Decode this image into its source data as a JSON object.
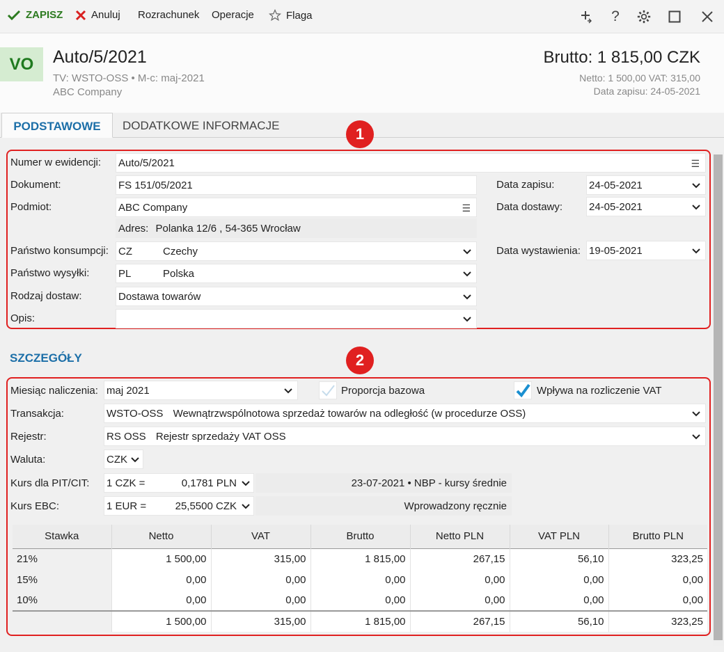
{
  "toolbar": {
    "save": "ZAPISZ",
    "cancel": "Anuluj",
    "rozrachunek": "Rozrachunek",
    "operacje": "Operacje",
    "flaga": "Flaga"
  },
  "header": {
    "badge": "VO",
    "title": "Auto/5/2021",
    "tv_line": "TV: WSTO-OSS  •  M-c: maj-2021",
    "company": "ABC Company",
    "brutto": "Brutto: 1 815,00 CZK",
    "netto_vat": "Netto: 1 500,00 VAT: 315,00",
    "data_zapisu": "Data zapisu: 24-05-2021"
  },
  "tabs": {
    "basic": "PODSTAWOWE",
    "extra": "DODATKOWE INFORMACJE"
  },
  "badges": {
    "one": "1",
    "two": "2"
  },
  "form": {
    "numer_label": "Numer w ewidencji:",
    "numer_value": "Auto/5/2021",
    "dokument_label": "Dokument:",
    "dokument_value": "FS 151/05/2021",
    "podmiot_label": "Podmiot:",
    "podmiot_value": "ABC Company",
    "adres_label": "Adres:",
    "adres_value": "Polanka  12/6 , 54-365 Wrocław",
    "panstwo_konsumpcji_label": "Państwo konsumpcji:",
    "panstwo_konsumpcji_code": "CZ",
    "panstwo_konsumpcji_name": "Czechy",
    "panstwo_wysylki_label": "Państwo wysyłki:",
    "panstwo_wysylki_code": "PL",
    "panstwo_wysylki_name": "Polska",
    "rodzaj_label": "Rodzaj dostaw:",
    "rodzaj_value": "Dostawa towarów",
    "opis_label": "Opis:",
    "opis_value": "",
    "data_zapisu_label": "Data zapisu:",
    "data_zapisu_value": "24-05-2021",
    "data_dostawy_label": "Data dostawy:",
    "data_dostawy_value": "24-05-2021",
    "data_wystawienia_label": "Data wystawienia:",
    "data_wystawienia_value": "19-05-2021"
  },
  "details": {
    "section_title": "SZCZEGÓŁY",
    "miesiac_label": "Miesiąc naliczenia:",
    "miesiac_value": "maj 2021",
    "proporcja_label": "Proporcja bazowa",
    "proporcja_checked": false,
    "wplywa_label": "Wpływa na rozliczenie VAT",
    "wplywa_checked": true,
    "transakcja_label": "Transakcja:",
    "transakcja_code": "WSTO-OSS",
    "transakcja_name": "Wewnątrzwspólnotowa sprzedaż towarów na odległość (w procedurze OSS)",
    "rejestr_label": "Rejestr:",
    "rejestr_code": "RS OSS",
    "rejestr_name": "Rejestr sprzedaży VAT OSS",
    "waluta_label": "Waluta:",
    "waluta_value": "CZK",
    "kurs_pit_label": "Kurs dla PIT/CIT:",
    "kurs_pit_unit": "1 CZK =",
    "kurs_pit_value": "0,1781 PLN",
    "kurs_pit_info": "23-07-2021 • NBP - kursy średnie",
    "kurs_ebc_label": "Kurs EBC:",
    "kurs_ebc_unit": "1 EUR =",
    "kurs_ebc_value": "25,5500 CZK",
    "kurs_ebc_info": "Wprowadzony ręcznie"
  },
  "table": {
    "headers": [
      "Stawka",
      "Netto",
      "VAT",
      "Brutto",
      "Netto PLN",
      "VAT PLN",
      "Brutto PLN"
    ],
    "rows": [
      [
        "21%",
        "1 500,00",
        "315,00",
        "1 815,00",
        "267,15",
        "56,10",
        "323,25"
      ],
      [
        "15%",
        "0,00",
        "0,00",
        "0,00",
        "0,00",
        "0,00",
        "0,00"
      ],
      [
        "10%",
        "0,00",
        "0,00",
        "0,00",
        "0,00",
        "0,00",
        "0,00"
      ]
    ],
    "total": [
      "",
      "1 500,00",
      "315,00",
      "1 815,00",
      "267,15",
      "56,10",
      "323,25"
    ]
  },
  "colors": {
    "accent_blue": "#1c6fa8",
    "save_green": "#2c7a1f",
    "highlight_red": "#e02020",
    "check_blue": "#1a8fd0"
  }
}
